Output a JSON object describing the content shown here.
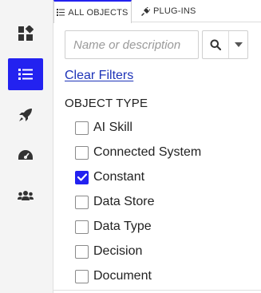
{
  "rail": {
    "items": [
      {
        "icon": "dashboard-icon",
        "active": false
      },
      {
        "icon": "list-icon",
        "active": true
      },
      {
        "icon": "rocket-icon",
        "active": false
      },
      {
        "icon": "gauge-icon",
        "active": false
      },
      {
        "icon": "users-icon",
        "active": false
      }
    ],
    "active_color": "#2322f0"
  },
  "tabs": [
    {
      "label": "ALL OBJECTS",
      "icon": "list-icon",
      "active": true
    },
    {
      "label": "PLUG-INS",
      "icon": "plug-icon",
      "active": false
    }
  ],
  "search": {
    "placeholder": "Name or description",
    "value": ""
  },
  "filters": {
    "clear_label": "Clear Filters",
    "section_title": "OBJECT TYPE",
    "options": [
      {
        "label": "AI Skill",
        "checked": false
      },
      {
        "label": "Connected System",
        "checked": false
      },
      {
        "label": "Constant",
        "checked": true
      },
      {
        "label": "Data Store",
        "checked": false
      },
      {
        "label": "Data Type",
        "checked": false
      },
      {
        "label": "Decision",
        "checked": false
      },
      {
        "label": "Document",
        "checked": false
      }
    ]
  },
  "colors": {
    "accent": "#2322f0",
    "link": "#1d33b8",
    "rail_bg": "#f4f4f4"
  }
}
